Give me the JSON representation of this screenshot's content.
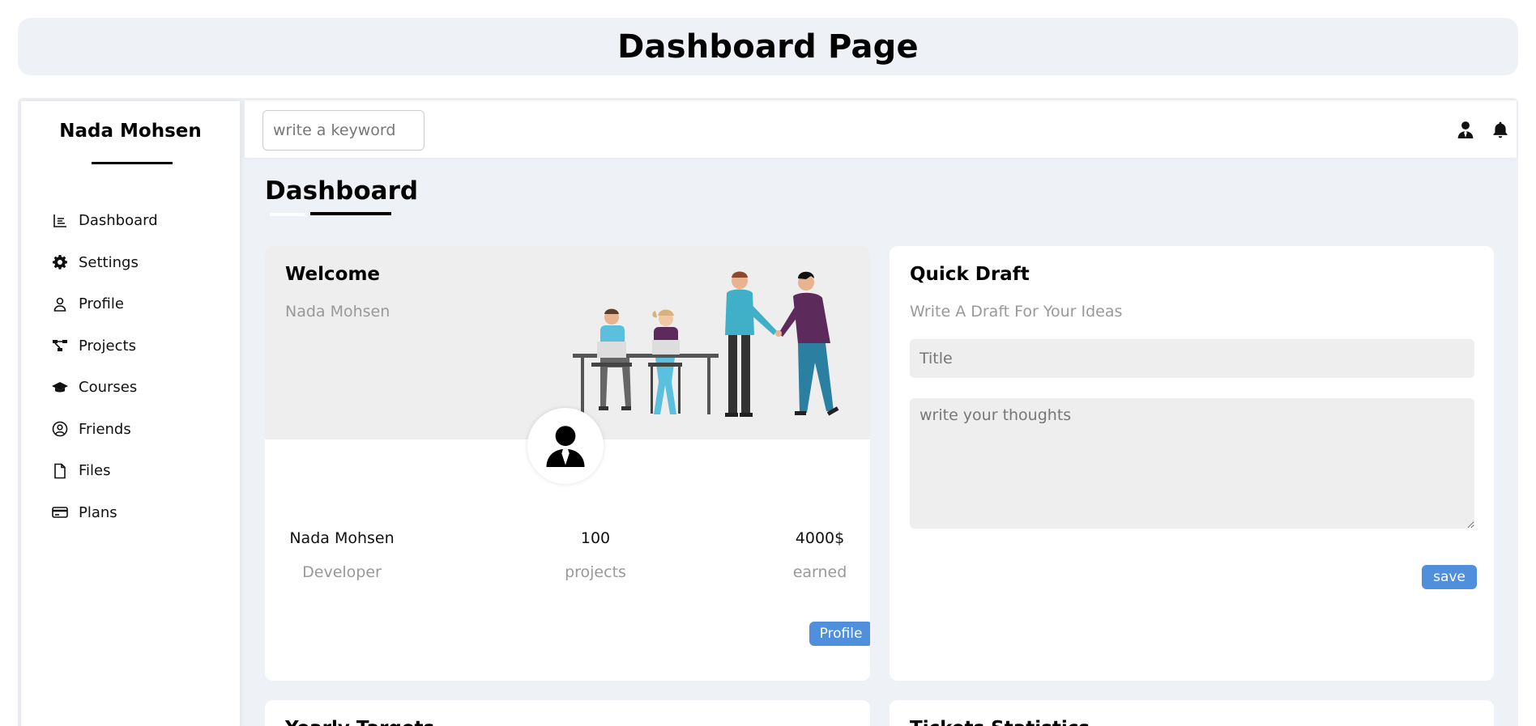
{
  "header": {
    "title": "Dashboard Page"
  },
  "sidebar": {
    "user_name": "Nada Mohsen",
    "items": [
      {
        "label": "Dashboard",
        "icon": "chart-icon"
      },
      {
        "label": "Settings",
        "icon": "gear-icon"
      },
      {
        "label": "Profile",
        "icon": "user-icon"
      },
      {
        "label": "Projects",
        "icon": "diagram-icon"
      },
      {
        "label": "Courses",
        "icon": "graduation-cap-icon"
      },
      {
        "label": "Friends",
        "icon": "circle-user-icon"
      },
      {
        "label": "Files",
        "icon": "file-icon"
      },
      {
        "label": "Plans",
        "icon": "credit-card-icon"
      }
    ]
  },
  "topbar": {
    "search_placeholder": "write a keyword",
    "icons": [
      "user-tie-icon",
      "bell-icon"
    ]
  },
  "main": {
    "title": "Dashboard",
    "welcome": {
      "title": "Welcome",
      "subtitle": "Nada Mohsen",
      "stats": [
        {
          "value": "Nada Mohsen",
          "label": "Developer"
        },
        {
          "value": "100",
          "label": "projects"
        },
        {
          "value": "4000$",
          "label": "earned"
        }
      ],
      "button": "Profile"
    },
    "draft": {
      "title": "Quick Draft",
      "subtitle": "Write A Draft For Your Ideas",
      "title_placeholder": "Title",
      "thoughts_placeholder": "write your thoughts",
      "button": "save"
    },
    "bottom_cards": [
      {
        "title": "Yearly Targets"
      },
      {
        "title": "Tickets Statistics"
      }
    ]
  },
  "colors": {
    "accent": "#4f8fdb",
    "page_bg": "#eef1f6",
    "banner_bg": "#eeeeee"
  }
}
